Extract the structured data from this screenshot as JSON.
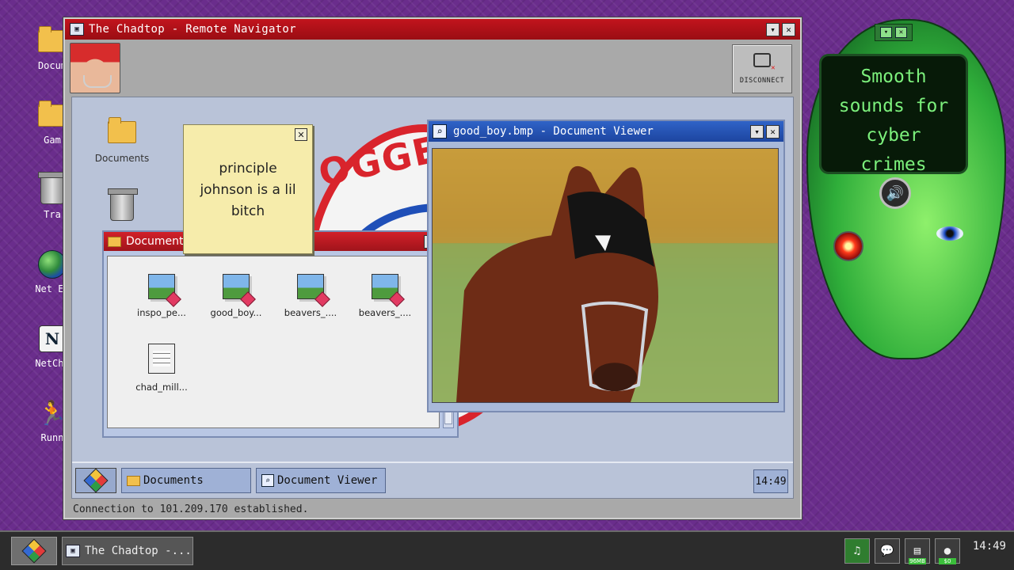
{
  "outer_desktop": {
    "icons": [
      {
        "label": "Docum"
      },
      {
        "label": "Gam"
      },
      {
        "label": "Tra"
      },
      {
        "label": "Net Ex"
      },
      {
        "label": "NetCha"
      },
      {
        "label": "Runn"
      }
    ]
  },
  "remote_window": {
    "title": "The Chadtop - Remote Navigator",
    "disconnect_label": "DISCONNECT",
    "status": "Connection to 101.209.170 established."
  },
  "remote_desktop": {
    "icons": [
      {
        "label": "Documents"
      },
      {
        "label": ""
      }
    ],
    "logo_text": "OGGET"
  },
  "sticky_note": {
    "close_glyph": "✕",
    "text_lines": [
      "principle",
      "johnson is a lil",
      "bitch"
    ]
  },
  "documents_window": {
    "title": "Document",
    "files": [
      {
        "label": "inspo_pe...",
        "kind": "image"
      },
      {
        "label": "good_boy...",
        "kind": "image"
      },
      {
        "label": "beavers_....",
        "kind": "image"
      },
      {
        "label": "beavers_....",
        "kind": "image"
      },
      {
        "label": "chad_mill...",
        "kind": "document"
      }
    ]
  },
  "viewer_window": {
    "title": "good_boy.bmp - Document Viewer"
  },
  "inner_taskbar": {
    "items": [
      {
        "label": "Documents"
      },
      {
        "label": "Document Viewer"
      }
    ],
    "clock": "14:49"
  },
  "cyber_head": {
    "screen_lines": [
      "Smooth",
      "sounds for",
      "cyber",
      "crimes"
    ]
  },
  "outer_taskbar": {
    "task_label": "The Chadtop -...",
    "tray": {
      "ram_badge": "96MB",
      "money_badge": "$0"
    },
    "clock": "14:49"
  },
  "colors": {
    "desktop_bg": "#6a2d8c",
    "title_red": "#c2141d",
    "title_blue": "#2f63c7",
    "terminal_green": "#7cf07c"
  }
}
